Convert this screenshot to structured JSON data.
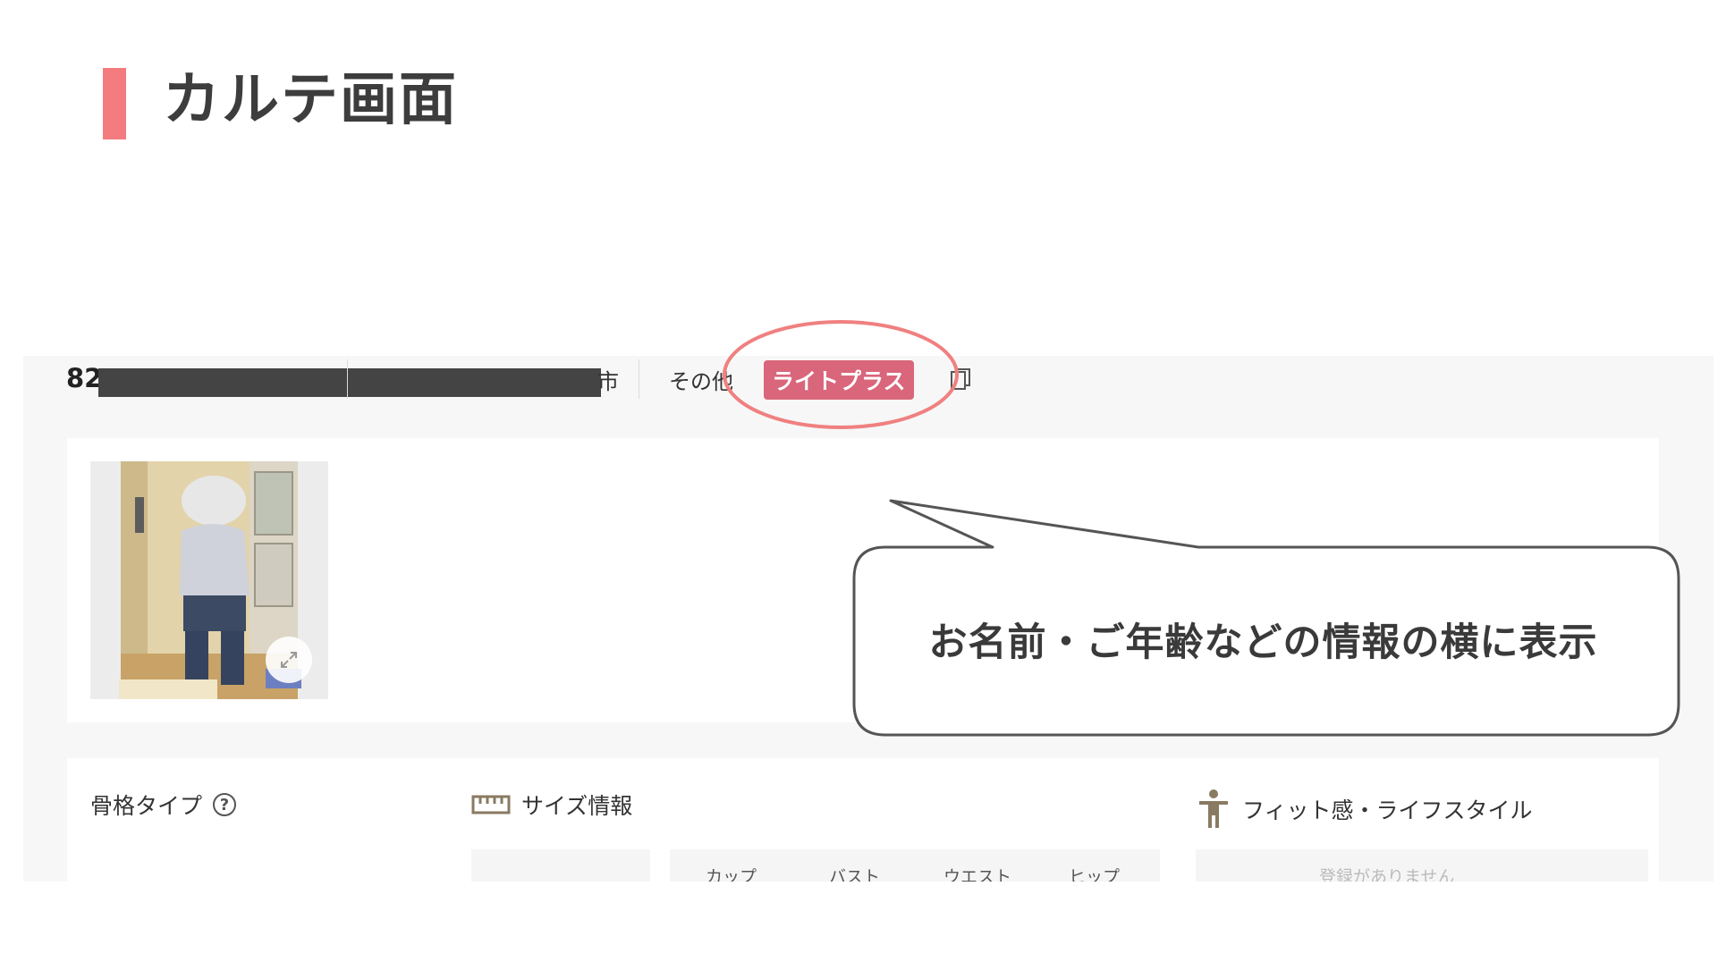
{
  "slide": {
    "title": "カルテ画面"
  },
  "header": {
    "member_id_prefix": "82",
    "city_suffix": "市",
    "category": "その他",
    "plan_badge": "ライトプラス"
  },
  "profile_card": {
    "photo_alt": "全身写真",
    "expand_icon": "expand-icon"
  },
  "info_card": {
    "skeleton_title": "骨格タイプ",
    "size_title": "サイズ情報",
    "fit_title": "フィット感・ライフスタイル",
    "size_columns": [
      "カップ",
      "バスト",
      "ウエスト",
      "ヒップ"
    ],
    "fit_empty_text": "登録がありません"
  },
  "annotation": {
    "callout_text": "お名前・ご年齢などの情報の横に表示"
  },
  "colors": {
    "accent_bar": "#f47c7f",
    "badge": "#d9667b",
    "highlight_ellipse": "#f08080"
  }
}
